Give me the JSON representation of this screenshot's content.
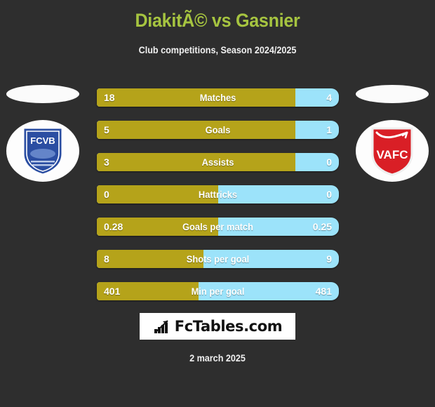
{
  "header": {
    "title": "DiakitÃ© vs Gasnier",
    "subtitle": "Club competitions, Season 2024/2025"
  },
  "teams": {
    "home": {
      "crest_label": "FCVB",
      "crest_icon": "fcvb-crest-icon"
    },
    "away": {
      "crest_label": "VAFC",
      "crest_icon": "vafc-crest-icon"
    }
  },
  "colors": {
    "background": "#2e2e2e",
    "title": "#a6c440",
    "home_bar": "#b5a31a",
    "away_bar": "#9ce3fa",
    "value_text": "#ffffff"
  },
  "chart_data": {
    "type": "bar",
    "title": "DiakitÃ© vs Gasnier",
    "subtitle": "Club competitions, Season 2024/2025",
    "orientation": "horizontal-diverging",
    "legend": [
      "DiakitÃ© (FCVB)",
      "Gasnier (VAFC)"
    ],
    "categories": [
      "Matches",
      "Goals",
      "Assists",
      "Hattricks",
      "Goals per match",
      "Shots per goal",
      "Min per goal"
    ],
    "series": [
      {
        "name": "DiakitÃ©",
        "color": "#b5a31a",
        "values": [
          "18",
          "5",
          "3",
          "0",
          "0.28",
          "8",
          "401"
        ]
      },
      {
        "name": "Gasnier",
        "color": "#9ce3fa",
        "values": [
          "4",
          "1",
          "0",
          "0",
          "0.25",
          "9",
          "481"
        ]
      }
    ],
    "home_share_percent": [
      82,
      82,
      82,
      50,
      50,
      44,
      42
    ]
  },
  "rows": [
    {
      "label": "Matches",
      "home": "18",
      "away": "4",
      "home_pct": 82
    },
    {
      "label": "Goals",
      "home": "5",
      "away": "1",
      "home_pct": 82
    },
    {
      "label": "Assists",
      "home": "3",
      "away": "0",
      "home_pct": 82
    },
    {
      "label": "Hattricks",
      "home": "0",
      "away": "0",
      "home_pct": 50
    },
    {
      "label": "Goals per match",
      "home": "0.28",
      "away": "0.25",
      "home_pct": 50
    },
    {
      "label": "Shots per goal",
      "home": "8",
      "away": "9",
      "home_pct": 44
    },
    {
      "label": "Min per goal",
      "home": "401",
      "away": "481",
      "home_pct": 42
    }
  ],
  "footer": {
    "logo_text": "FcTables.com",
    "logo_icon": "bar-chart-icon",
    "date": "2 march 2025"
  }
}
